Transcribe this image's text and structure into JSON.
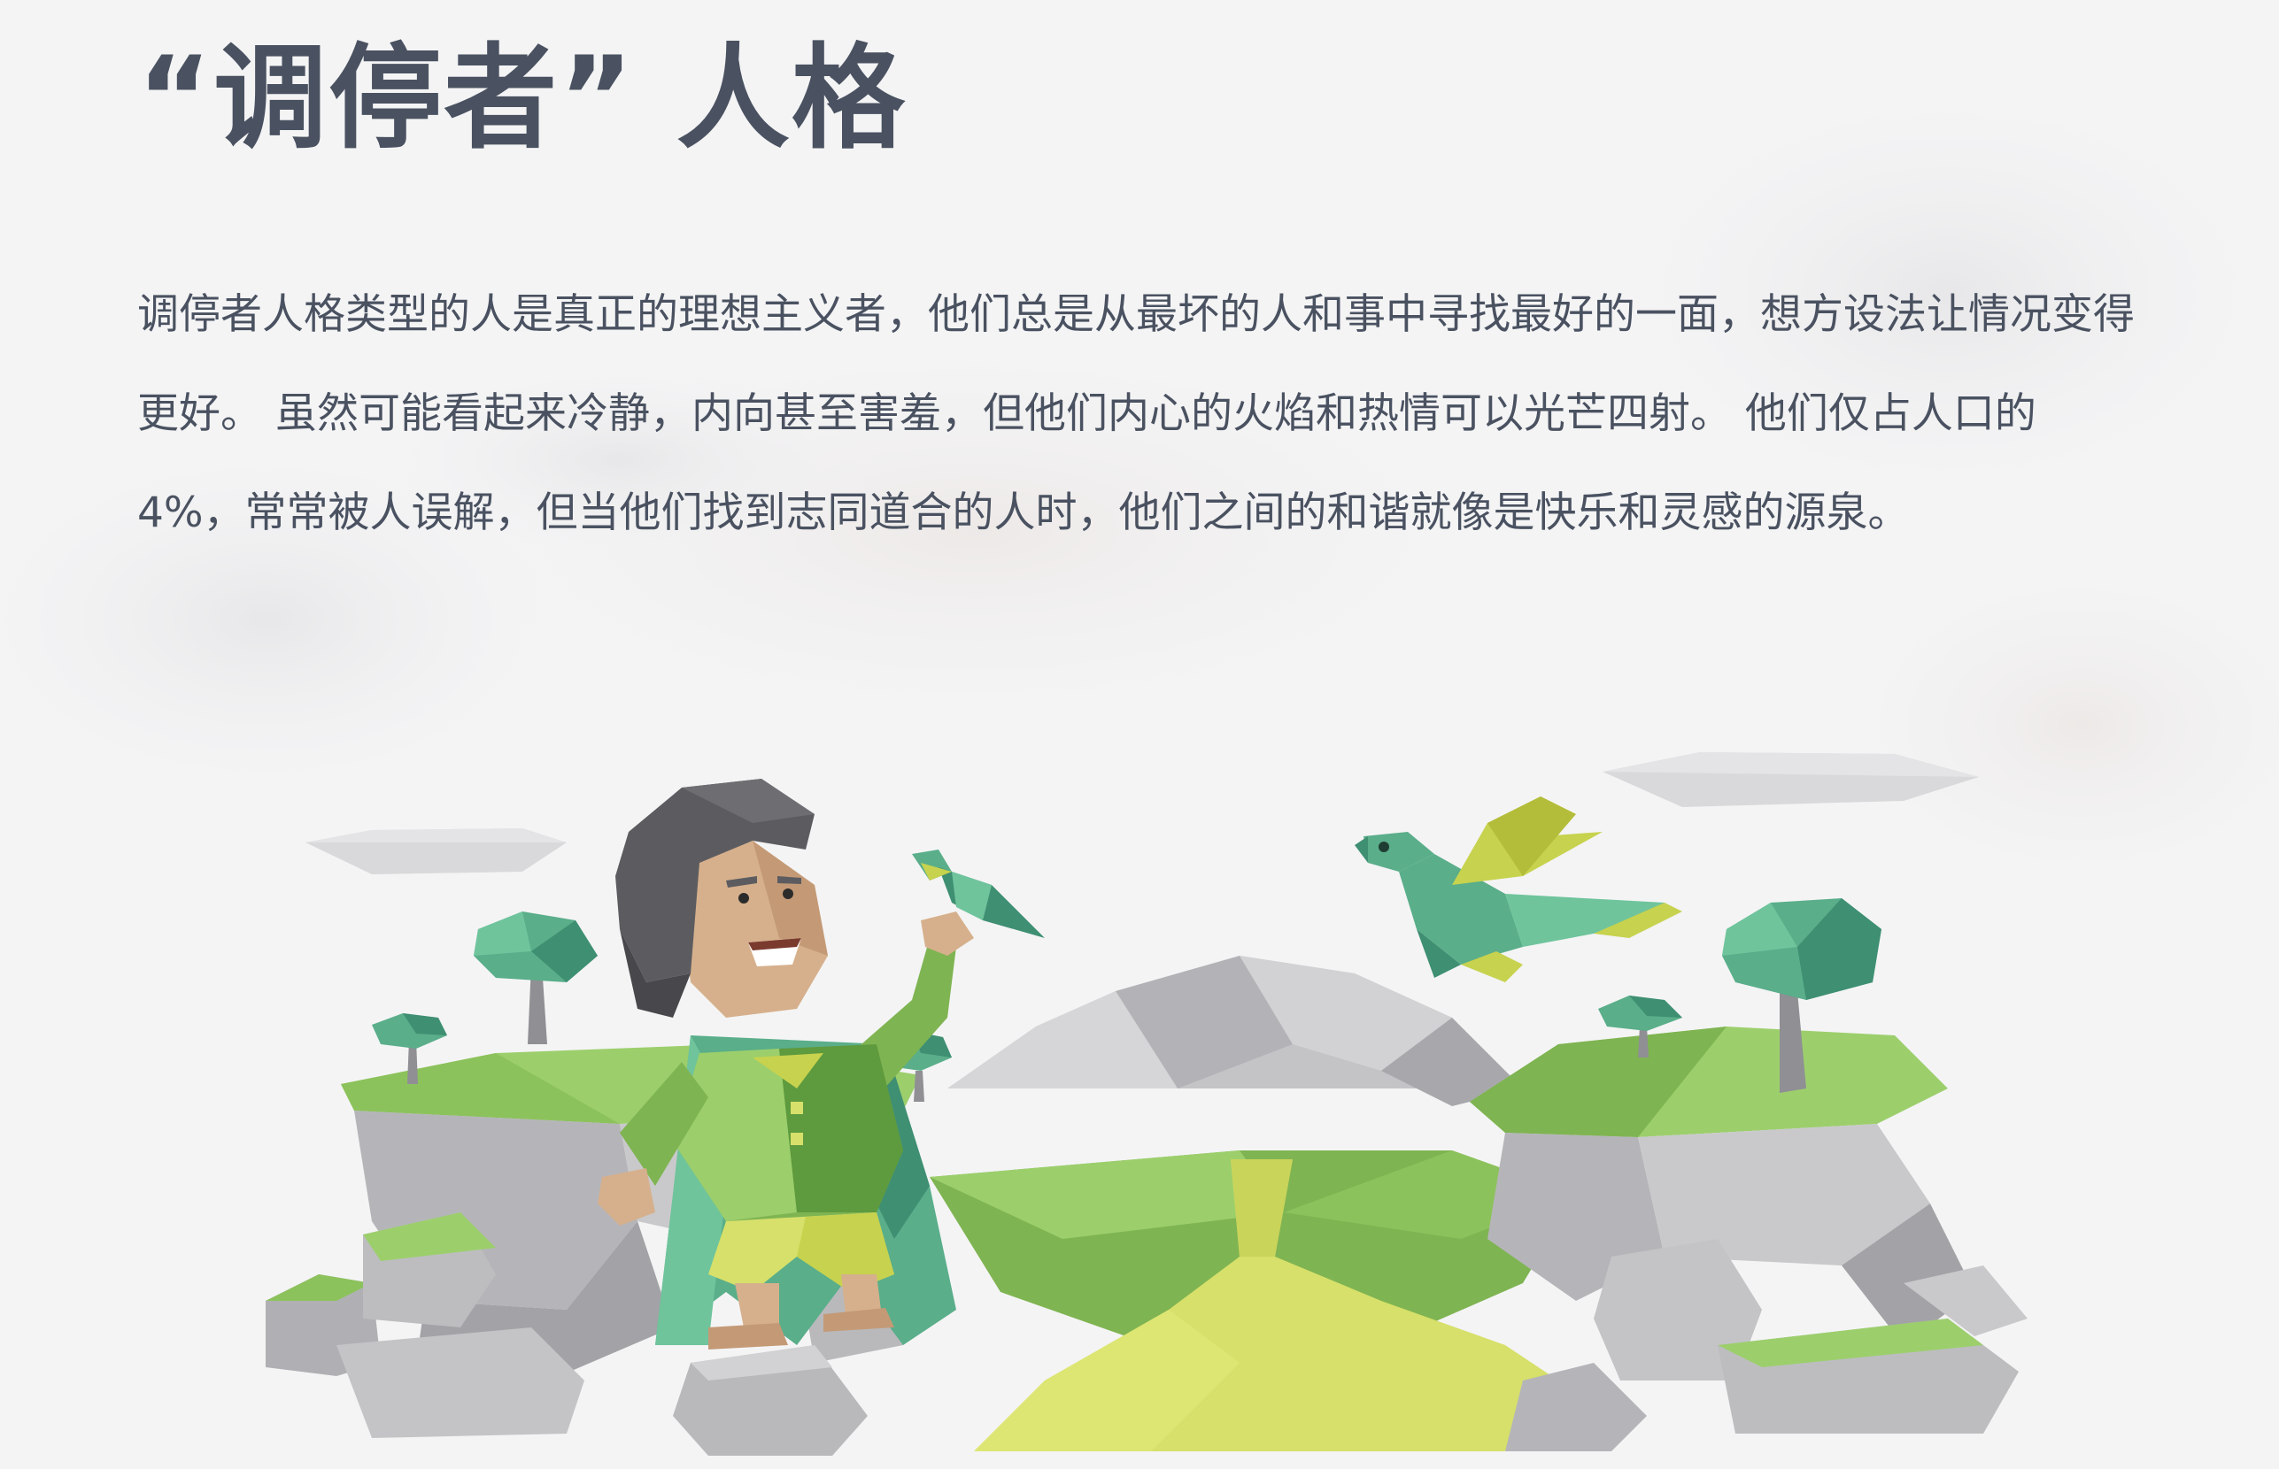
{
  "heading": {
    "title": "“调停者” 人格"
  },
  "intro": {
    "paragraph": "调停者人格类型的人是真正的理想主义者，他们总是从最坏的人和事中寻找最好的一面，想方设法让情况变得更好。 虽然可能看起来冷静，内向甚至害羞，但他们内心的火焰和热情可以光芒四射。 他们仅占人口的 4%，常常被人误解，但当他们找到志同道合的人时，他们之间的和谐就像是快乐和灵感的源泉。"
  },
  "illustration": {
    "palette": {
      "rock_light": "#c9c9cb",
      "rock_mid": "#a9a9ad",
      "rock_dark": "#8f8f94",
      "grass_light": "#9ccf6c",
      "grass_mid": "#7fb452",
      "grass_dark": "#5e9a3e",
      "river": "#d6e06a",
      "teal": "#5aae8a",
      "teal_dark": "#3f8f72",
      "yellow_green": "#c7d24e"
    },
    "elements": [
      "floating-islands",
      "mediator-character",
      "origami-bird",
      "origami-dragon",
      "trees",
      "clouds",
      "river"
    ]
  }
}
